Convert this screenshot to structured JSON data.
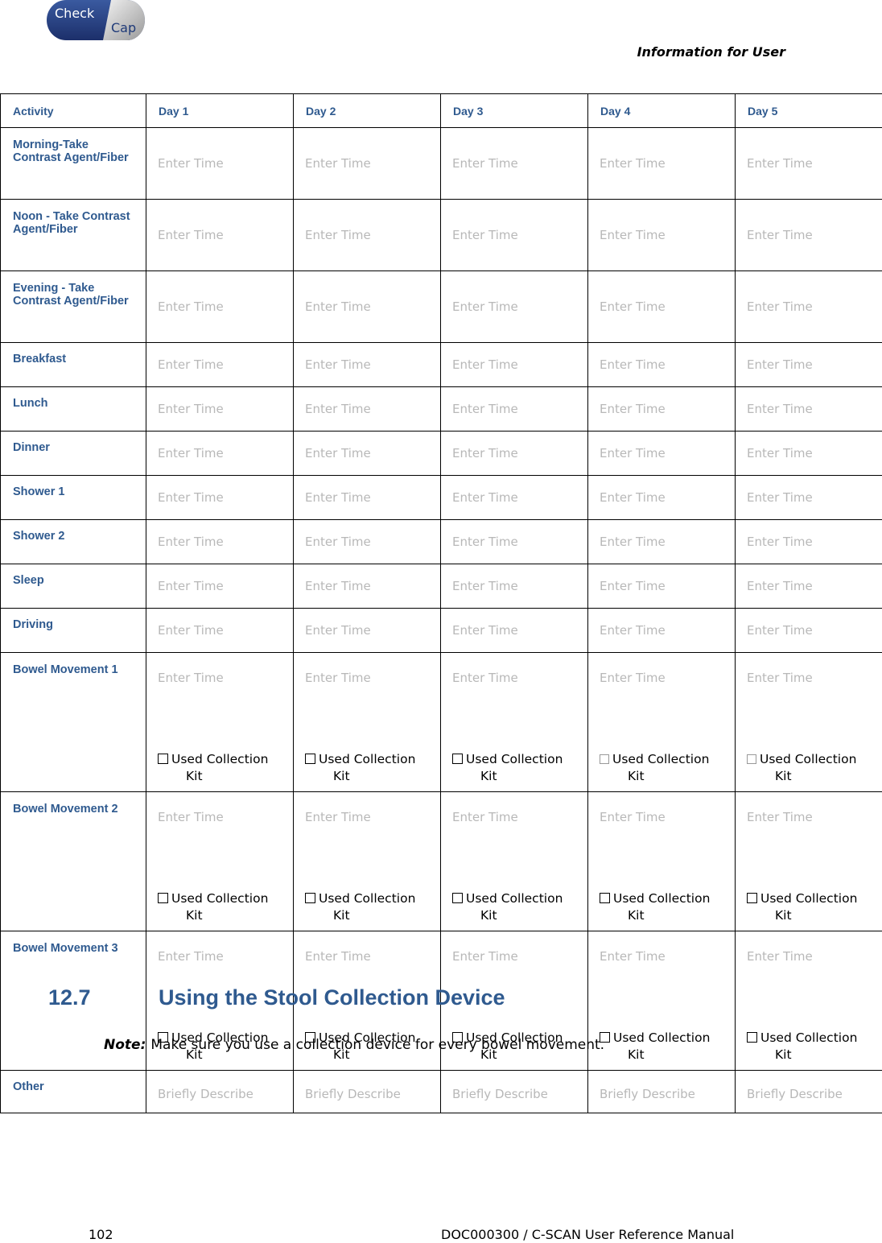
{
  "header": {
    "logo_text_1": "Check",
    "logo_text_2": "Cap",
    "title": "Information for User"
  },
  "table": {
    "columns": [
      "Activity",
      "Day 1",
      "Day 2",
      "Day 3",
      "Day 4",
      "Day 5"
    ],
    "time_placeholder": "Enter Time",
    "describe_placeholder": "Briefly Describe",
    "kit_label_line1": "Used Collection",
    "kit_label_line2": "Kit",
    "rows": [
      {
        "activity": "Morning-Take Contrast Agent/Fiber",
        "type": "tall"
      },
      {
        "activity": "Noon - Take Contrast Agent/Fiber",
        "type": "tall"
      },
      {
        "activity": "Evening - Take Contrast Agent/Fiber",
        "type": "tall"
      },
      {
        "activity": "Breakfast",
        "type": "single"
      },
      {
        "activity": "Lunch",
        "type": "single"
      },
      {
        "activity": "Dinner",
        "type": "single"
      },
      {
        "activity": "Shower 1",
        "type": "single"
      },
      {
        "activity": "Shower 2",
        "type": "single"
      },
      {
        "activity": "Sleep",
        "type": "single"
      },
      {
        "activity": "Driving",
        "type": "single"
      },
      {
        "activity": "Bowel Movement 1",
        "type": "bowel"
      },
      {
        "activity": "Bowel Movement 2",
        "type": "bowel"
      },
      {
        "activity": "Bowel Movement 3",
        "type": "bowel"
      },
      {
        "activity": "Other",
        "type": "other"
      }
    ]
  },
  "section": {
    "number": "12.7",
    "title": "Using the Stool Collection Device"
  },
  "note": {
    "label": "Note:",
    "text": "Make sure you use a collection device for every bowel movement."
  },
  "footer": {
    "page_number": "102",
    "document": "DOC000300 / C-SCAN User Reference Manual"
  },
  "colors": {
    "heading_blue": "#2f5a8f",
    "placeholder_gray": "#b8b8b8",
    "logo_navy": "#1f3a78"
  }
}
